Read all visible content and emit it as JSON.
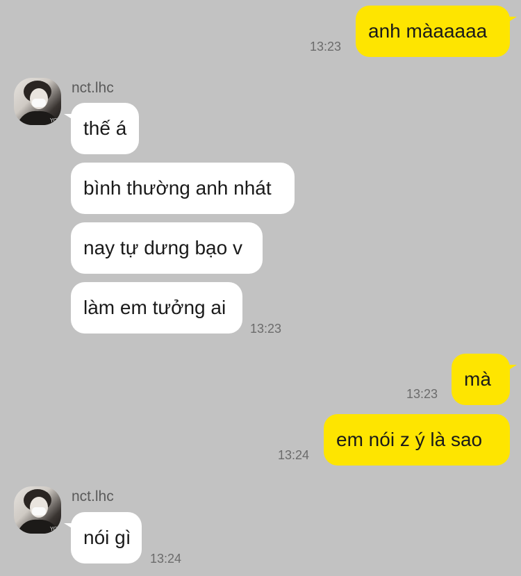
{
  "contact": {
    "name": "nct.lhc",
    "avatar_icon": "profile-photo-icon"
  },
  "colors": {
    "background": "#c2c2c2",
    "outgoing_bubble": "#fee500",
    "incoming_bubble": "#ffffff"
  },
  "messages": [
    {
      "direction": "out",
      "text": "anh màaaaaa",
      "time": "13:23"
    },
    {
      "direction": "in",
      "text": "thế á",
      "time": ""
    },
    {
      "direction": "in",
      "text": "bình thường anh nhát",
      "time": ""
    },
    {
      "direction": "in",
      "text": "nay tự dưng bạo v",
      "time": ""
    },
    {
      "direction": "in",
      "text": "làm em tưởng ai",
      "time": "13:23"
    },
    {
      "direction": "out",
      "text": "mà",
      "time": "13:23"
    },
    {
      "direction": "out",
      "text": "em nói z ý là sao",
      "time": "13:24"
    },
    {
      "direction": "in",
      "text": "nói gì",
      "time": "13:24"
    }
  ]
}
